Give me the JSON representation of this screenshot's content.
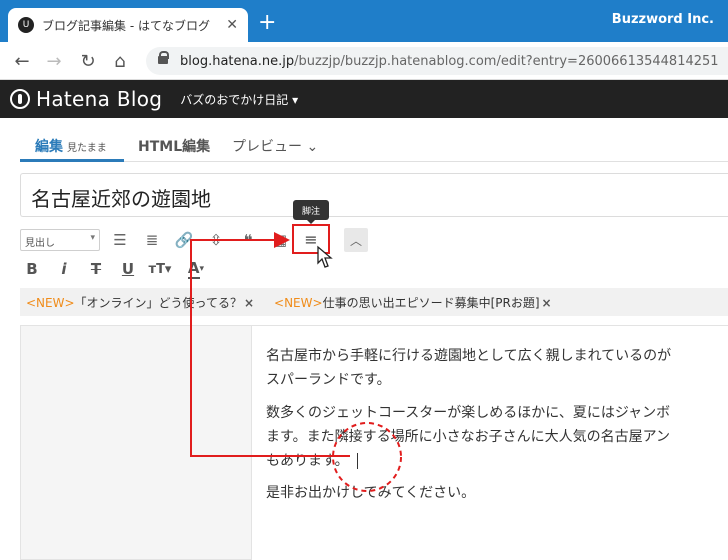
{
  "browser": {
    "tab_title": "ブログ記事編集 - はてなブログ",
    "profile_name": "Buzzword Inc.",
    "url_host": "blog.hatena.ne.jp",
    "url_path": "/buzzjp/buzzjp.hatenablog.com/edit?entry=26006613544814251"
  },
  "header": {
    "brand": "Hatena Blog",
    "blog_name": "バズのおでかけ日記 ▾"
  },
  "editor_tabs": [
    {
      "label": "編集",
      "sub": "見たまま"
    },
    {
      "label": "HTML編集",
      "sub": ""
    },
    {
      "label": "プレビュー ⌄",
      "sub": ""
    }
  ],
  "title_value": "名古屋近郊の遊園地",
  "toolbar": {
    "heading_select": "見出し",
    "tooltip": "脚注"
  },
  "topics": [
    {
      "tag": "<NEW>",
      "text": "「オンライン」どう使ってる？"
    },
    {
      "tag": "<NEW>",
      "text": "仕事の思い出エピソード募集中[PRお題]"
    }
  ],
  "body": {
    "p1_line1": "名古屋市から手軽に行ける遊園地として広く親しまれているのが",
    "p1_line2": "スパーランドです。",
    "p2_line1": "数多くのジェットコースターが楽しめるほかに、夏にはジャンボ",
    "p2_line2": "ます。また隣接する場所に小さなお子さんに大人気の名古屋アン",
    "p2_line3": "もあります。",
    "p3": "是非お出かけしてみてください。"
  },
  "colors": {
    "accent": "#2b7bb9",
    "annotation": "#e11d1d",
    "new_tag": "#f08c1a"
  }
}
